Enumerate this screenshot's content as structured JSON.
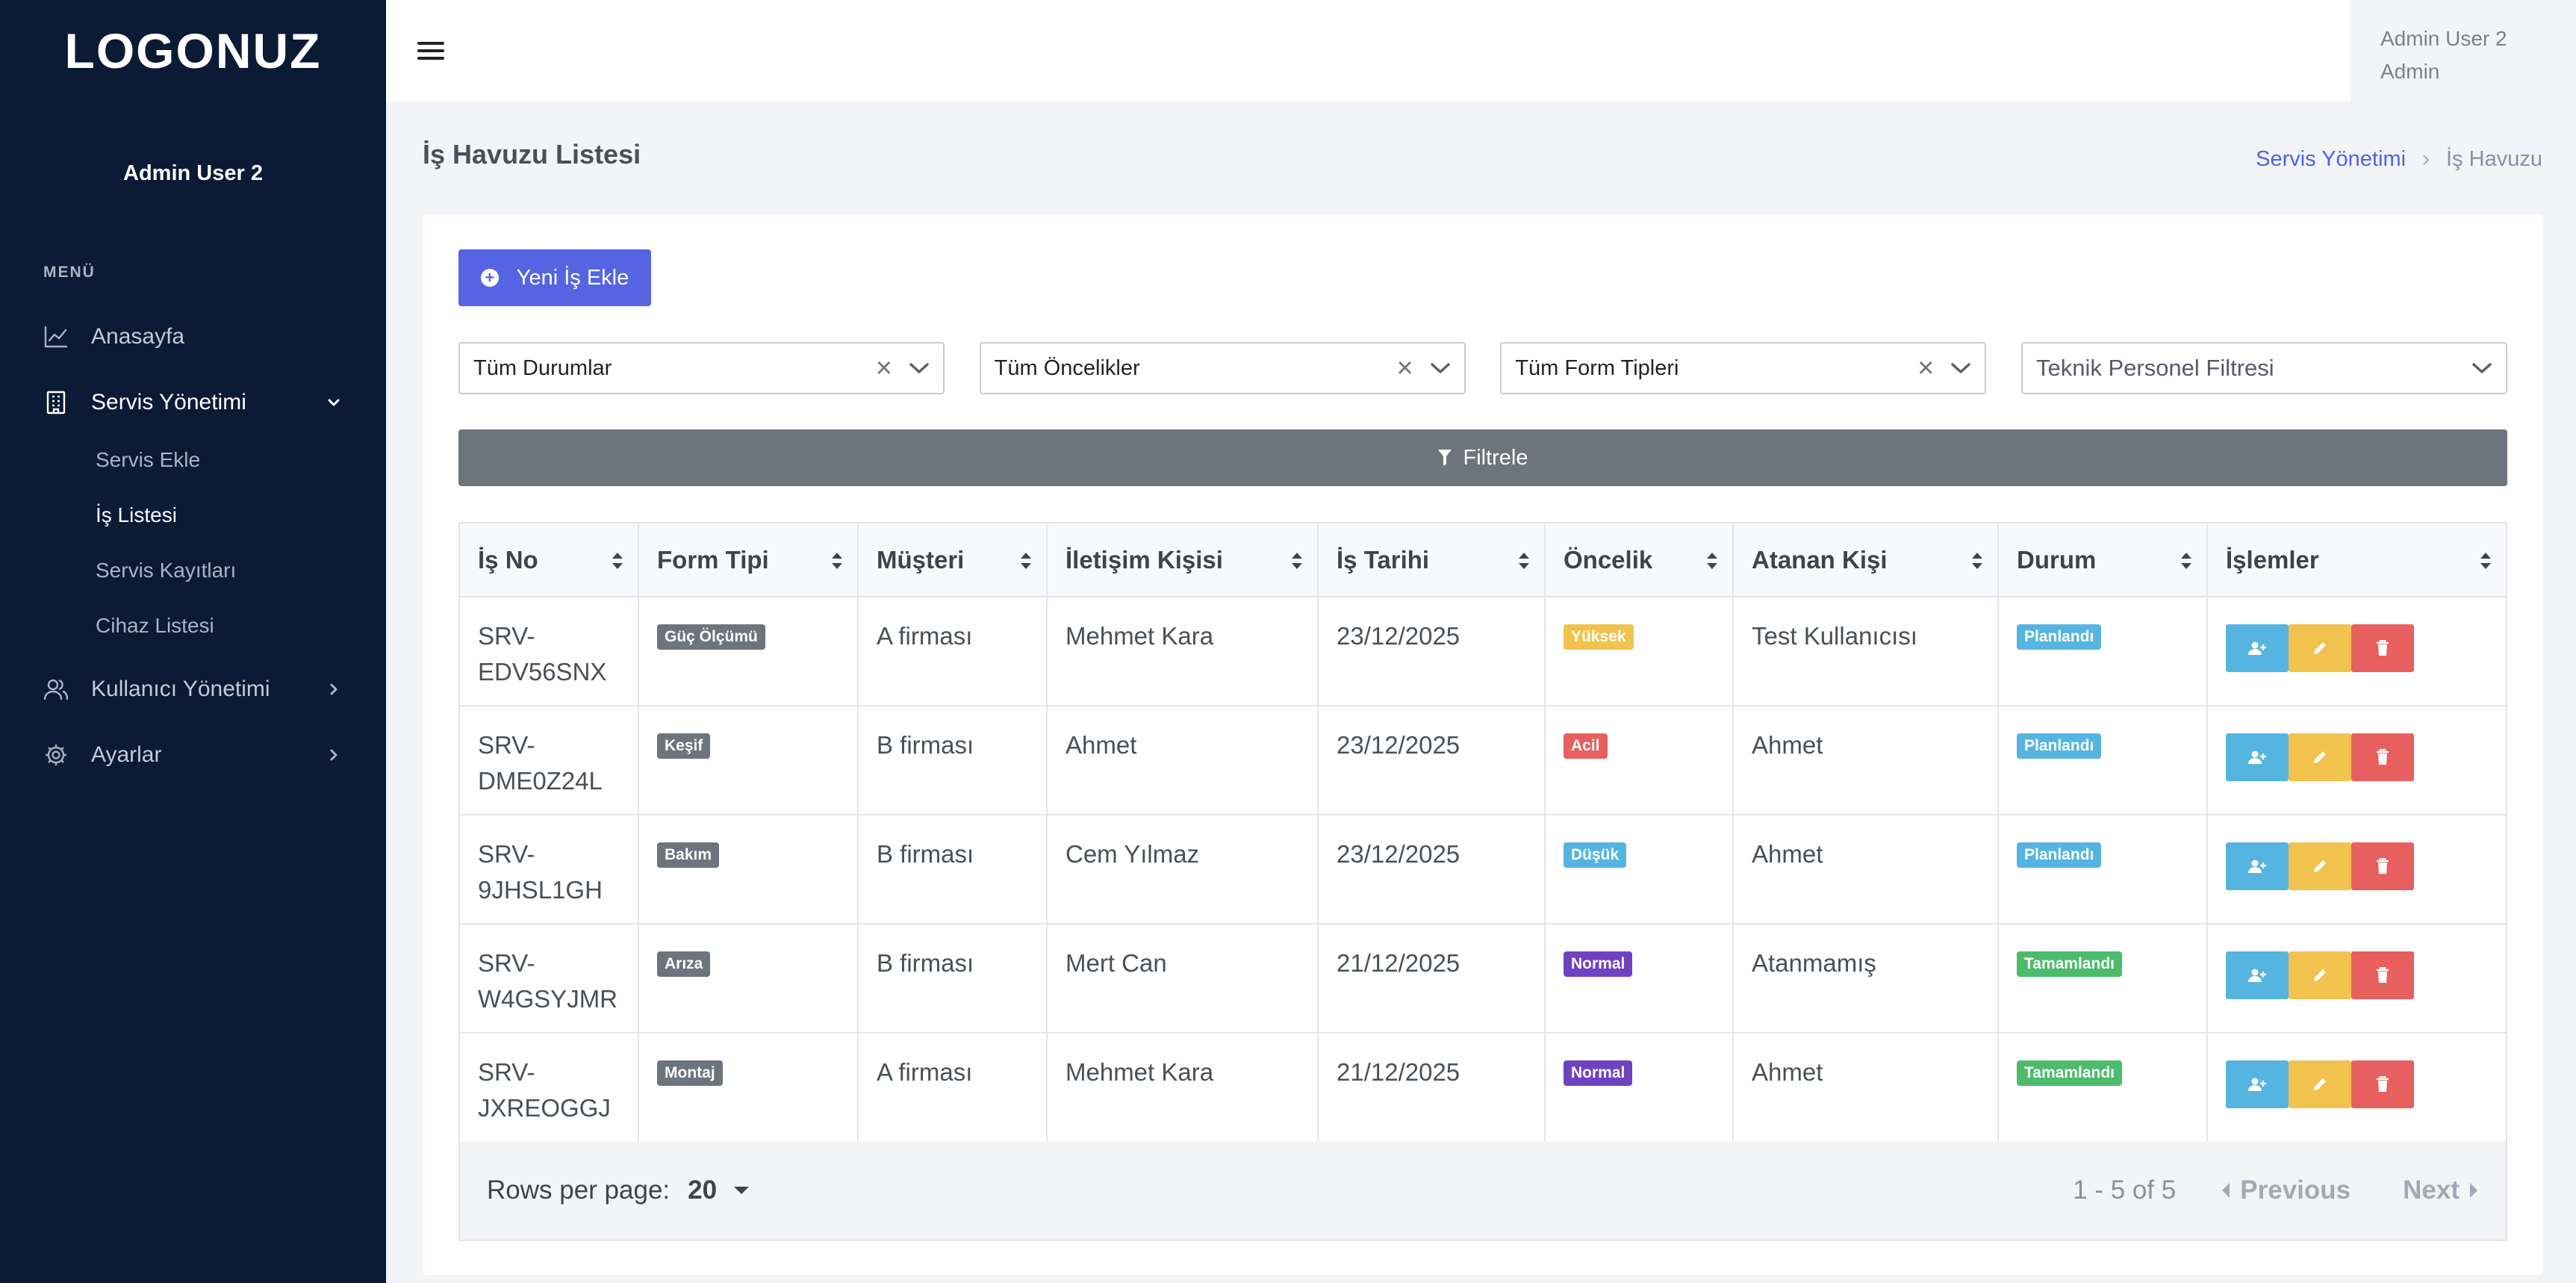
{
  "sidebar": {
    "logo": "LOGONUZ",
    "user_name": "Admin User 2",
    "menu_title": "MENÜ",
    "items": [
      {
        "label": "Anasayfa"
      },
      {
        "label": "Servis Yönetimi",
        "submenu": [
          "Servis Ekle",
          "İş Listesi",
          "Servis Kayıtları",
          "Cihaz Listesi"
        ]
      },
      {
        "label": "Kullanıcı Yönetimi"
      },
      {
        "label": "Ayarlar"
      }
    ]
  },
  "topbar": {
    "user_name": "Admin User 2",
    "user_role": "Admin"
  },
  "page": {
    "title": "İş Havuzu Listesi",
    "breadcrumb": [
      "Servis Yönetimi",
      "İş Havuzu"
    ]
  },
  "toolbar": {
    "add_label": "Yeni İş Ekle",
    "filters": [
      "Tüm Durumlar",
      "Tüm Öncelikler",
      "Tüm Form Tipleri",
      "Teknik Personel Filtresi"
    ],
    "filter_button": "Filtrele"
  },
  "table": {
    "columns": [
      "İş No",
      "Form Tipi",
      "Müşteri",
      "İletişim Kişisi",
      "İş Tarihi",
      "Öncelik",
      "Atanan Kişi",
      "Durum",
      "İşlemler"
    ],
    "rows": [
      {
        "no": "SRV-EDV56SNX",
        "form": "Güç Ölçümü",
        "customer": "A firması",
        "contact": "Mehmet Kara",
        "date": "23/12/2025",
        "priority": "Yüksek",
        "assignee": "Test Kullanıcısı",
        "status": "Planlandı"
      },
      {
        "no": "SRV-DME0Z24L",
        "form": "Keşif",
        "customer": "B firması",
        "contact": "Ahmet",
        "date": "23/12/2025",
        "priority": "Acil",
        "assignee": "Ahmet",
        "status": "Planlandı"
      },
      {
        "no": "SRV-9JHSL1GH",
        "form": "Bakım",
        "customer": "B firması",
        "contact": "Cem Yılmaz",
        "date": "23/12/2025",
        "priority": "Düşük",
        "assignee": "Ahmet",
        "status": "Planlandı"
      },
      {
        "no": "SRV-W4GSYJMR",
        "form": "Arıza",
        "customer": "B firması",
        "contact": "Mert Can",
        "date": "21/12/2025",
        "priority": "Normal",
        "assignee": "Atanmamış",
        "status": "Tamamlandı"
      },
      {
        "no": "SRV-JXREOGGJ",
        "form": "Montaj",
        "customer": "A firması",
        "contact": "Mehmet Kara",
        "date": "21/12/2025",
        "priority": "Normal",
        "assignee": "Ahmet",
        "status": "Tamamlandı"
      }
    ]
  },
  "pagination": {
    "rows_per_page_label": "Rows per page:",
    "rows_per_page": "20",
    "range": "1 - 5 of 5",
    "previous": "Previous",
    "next": "Next"
  },
  "colors": {
    "sidebar_bg": "#0b1a35",
    "primary": "#5664e3",
    "form_badge": "#6c757d",
    "priority": {
      "Yüksek": "#f2c24e",
      "Acil": "#e85f5f",
      "Düşük": "#55b5e0",
      "Normal": "#6f42c1"
    },
    "status": {
      "Planlandı": "#55b5e0",
      "Tamamlandı": "#4cbb6c"
    }
  }
}
